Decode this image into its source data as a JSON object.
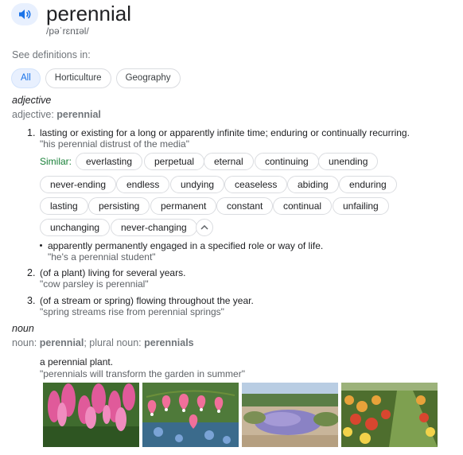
{
  "entry": {
    "word": "perennial",
    "phonetic": "/pəˈrɛnɪəl/",
    "audio_icon": "speaker-icon"
  },
  "see_definitions_label": "See definitions in:",
  "filters": [
    "All",
    "Horticulture",
    "Geography"
  ],
  "adjective": {
    "pos": "adjective",
    "line_label": "adjective:",
    "line_word": "perennial",
    "senses": [
      {
        "num": "1.",
        "definition": "lasting or existing for a long or apparently infinite time; enduring or continually recurring.",
        "example": "\"his perennial distrust of the media\""
      },
      {
        "num": "2.",
        "definition": "(of a plant) living for several years.",
        "example": "\"cow parsley is perennial\""
      },
      {
        "num": "3.",
        "definition": "(of a stream or spring) flowing throughout the year.",
        "example": "\"spring streams rise from perennial springs\""
      }
    ],
    "similar_label": "Similar:",
    "similar": [
      "everlasting",
      "perpetual",
      "eternal",
      "continuing",
      "unending",
      "never-ending",
      "endless",
      "undying",
      "ceaseless",
      "abiding",
      "enduring",
      "lasting",
      "persisting",
      "permanent",
      "constant",
      "continual",
      "unfailing",
      "unchanging",
      "never-changing"
    ],
    "subsense": {
      "definition": "apparently permanently engaged in a specified role or way of life.",
      "example": "\"he's a perennial student\""
    }
  },
  "noun": {
    "pos": "noun",
    "line_label": "noun:",
    "line_word": "perennial",
    "plural_label": "; plural noun:",
    "plural_word": "perennials",
    "definition": "a perennial plant.",
    "example": "\"perennials will transform the garden in summer\""
  },
  "images": [
    "pink-astilbe-image",
    "bleeding-heart-flowers-image",
    "lavender-garden-image",
    "flower-border-path-image"
  ],
  "colors": {
    "accent": "#1a73e8",
    "chip_active_bg": "#e8f0fe",
    "similar_green": "#188038",
    "muted": "#70757a"
  }
}
